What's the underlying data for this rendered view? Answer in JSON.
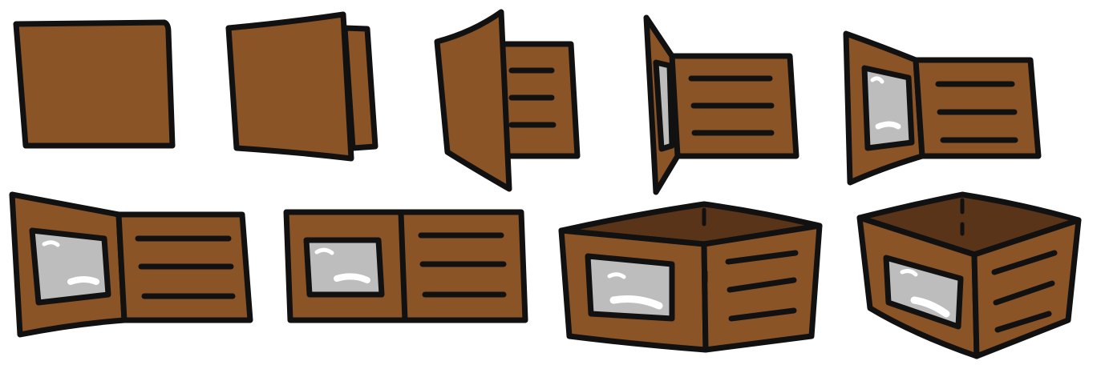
{
  "sequence": {
    "frame_count": 9,
    "frames": [
      {
        "id": "frame-1",
        "state": "closed"
      },
      {
        "id": "frame-2",
        "state": "opening-slightly"
      },
      {
        "id": "frame-3",
        "state": "opening-half"
      },
      {
        "id": "frame-4",
        "state": "opening-more"
      },
      {
        "id": "frame-5",
        "state": "opening-wide"
      },
      {
        "id": "frame-6",
        "state": "open-flat-tilted"
      },
      {
        "id": "frame-7",
        "state": "open-flat-front"
      },
      {
        "id": "frame-8",
        "state": "open-front-perspective"
      },
      {
        "id": "frame-9",
        "state": "open-angled-perspective"
      }
    ]
  },
  "colors": {
    "leather": "#8B5426",
    "leather_dark": "#5A3418",
    "outline": "#111111",
    "window": "#BDBDBD",
    "window_highlight": "#FFFFFF",
    "background": "#FFFFFF"
  },
  "icons": [
    "wallet-icon",
    "id-window-icon",
    "card-slot-lines-icon"
  ]
}
